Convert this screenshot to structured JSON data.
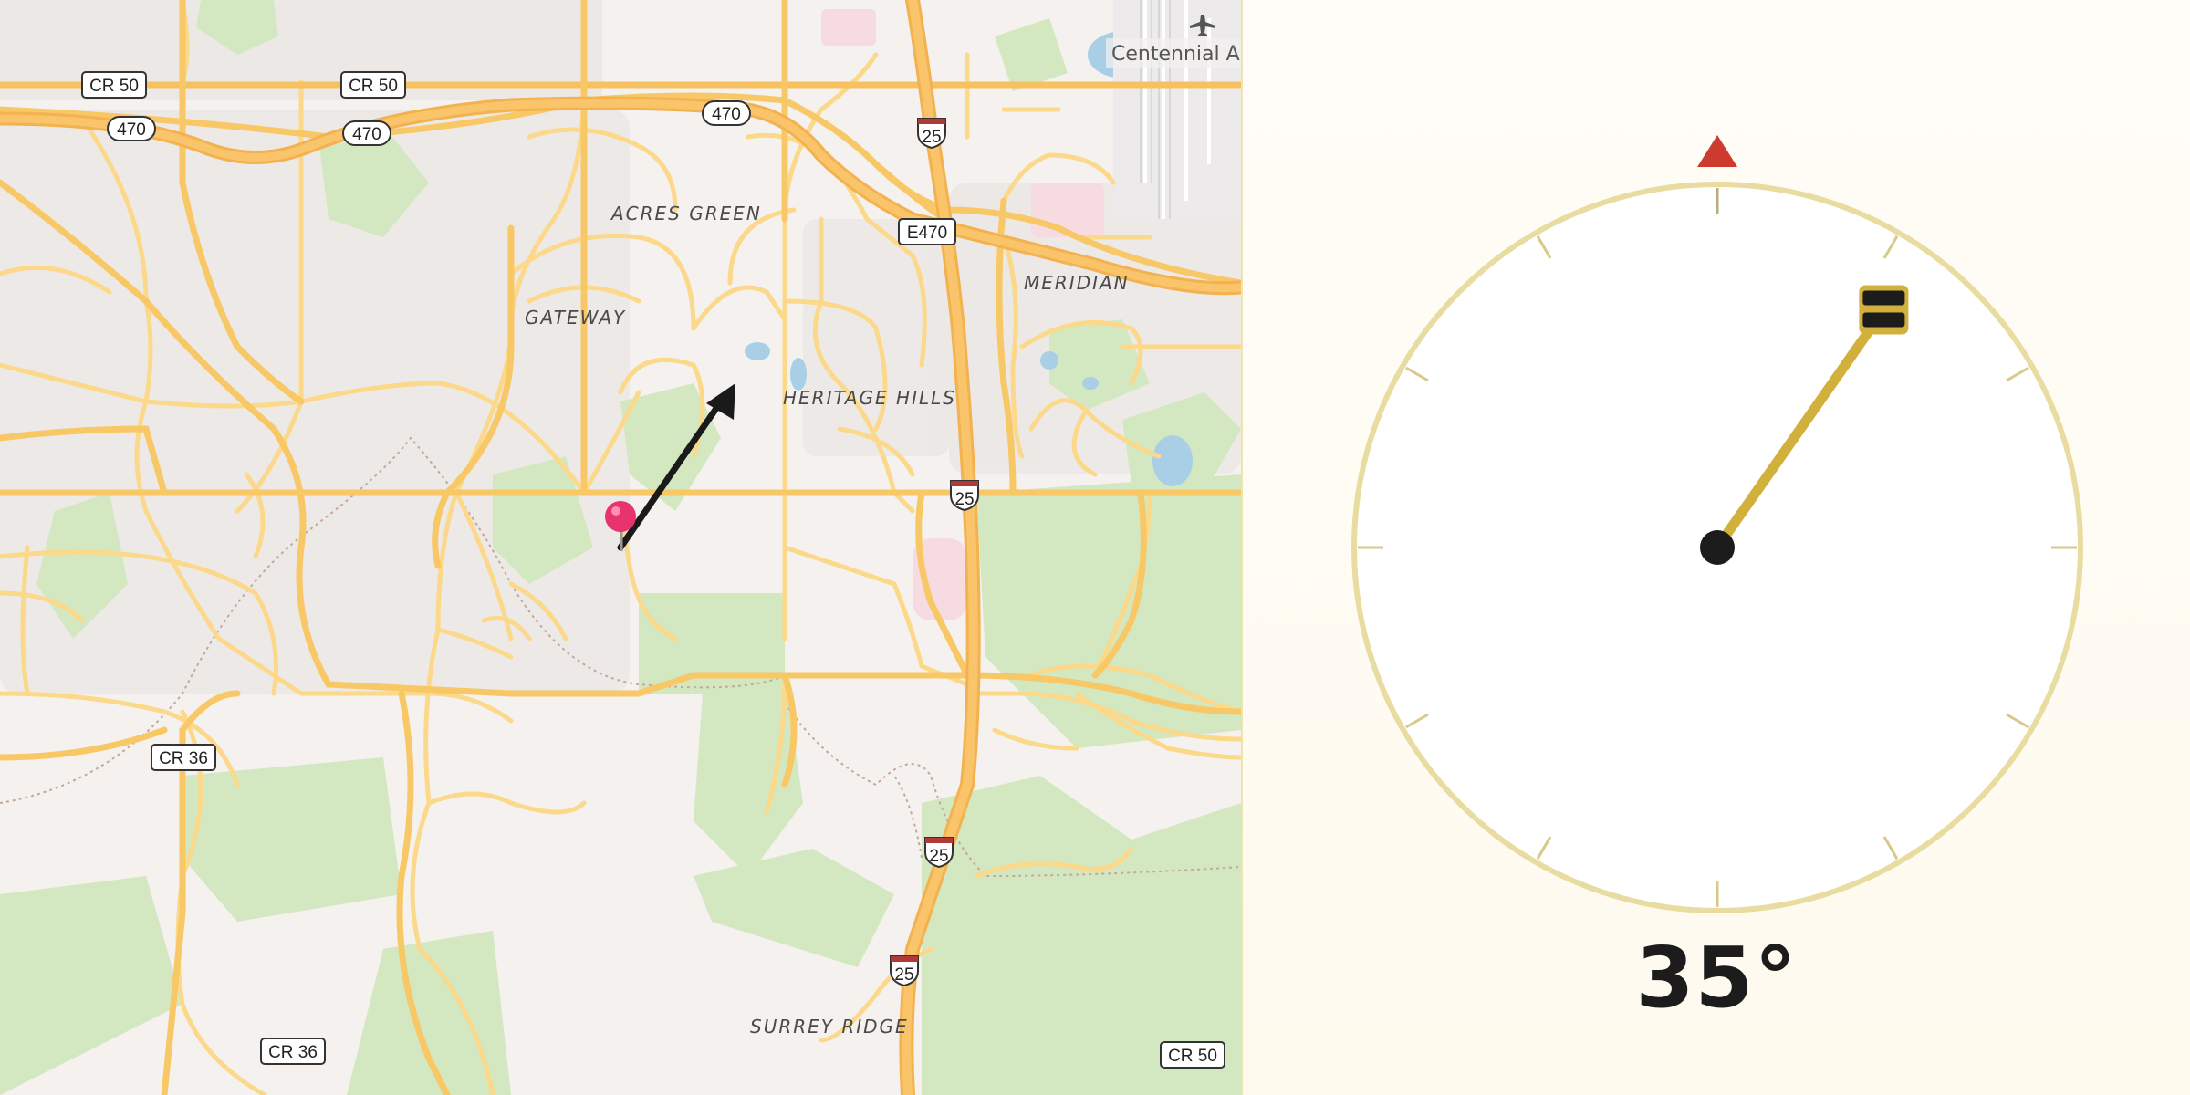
{
  "map": {
    "places": [
      {
        "id": "acres-green",
        "label": "ACRES GREEN"
      },
      {
        "id": "gateway",
        "label": "GATEWAY"
      },
      {
        "id": "meridian",
        "label": "MERIDIAN"
      },
      {
        "id": "heritage-hills",
        "label": "HERITAGE HILLS"
      },
      {
        "id": "surrey-ridge",
        "label": "SURREY RIDGE"
      }
    ],
    "airport": {
      "label": "Centennial Ai",
      "icon": "airplane-icon"
    },
    "road_shields": {
      "cr50": "CR 50",
      "cr36": "CR 36",
      "r470": "470",
      "e470": "E470",
      "i25": "25"
    },
    "pin": {
      "icon": "map-pin-icon",
      "color": "#e8336e"
    },
    "direction_arrow": {
      "icon": "direction-arrow-icon",
      "color": "#1a1a1a"
    },
    "colors": {
      "major_road": "#f8c867",
      "road": "#fcd98a",
      "green": "#d3e8c1",
      "water": "#a9cfe7",
      "background": "#f4f1ee"
    }
  },
  "compass": {
    "heading_deg": 35,
    "heading_label": "35°",
    "north_marker_color": "#cc3b2e",
    "needle_color": "#d2b03c",
    "ring_color": "#e8dca0"
  }
}
